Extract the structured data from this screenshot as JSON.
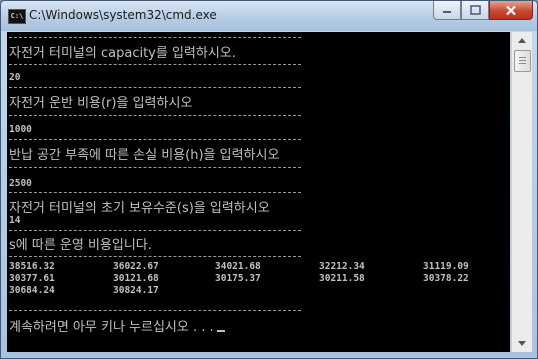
{
  "window": {
    "title": "C:\\Windows\\system32\\cmd.exe",
    "icon": "console-window-icon",
    "icon_text": "C:\\"
  },
  "controls": {
    "minimize": "minimize-icon",
    "maximize": "maximize-icon",
    "close": "close-icon"
  },
  "console": {
    "prompt_capacity": "자전거 터미널의 capacity를 입력하시오.",
    "capacity_value": "20",
    "prompt_transport_cost": "자전거 운반 비용(r)을 입력하시오",
    "transport_cost_value": "1000",
    "prompt_shortage_cost": "반납 공간 부족에 따른 손실 비용(h)을 입력하시오",
    "shortage_cost_value": "2500",
    "prompt_initial_stock": "자전거 터미널의 초기 보유수준(s)을 입력하시오",
    "initial_stock_value": "14",
    "result_header": "s에 따른 운영 비용입니다.",
    "results": [
      [
        "38516.32",
        "36022.67",
        "34021.68",
        "32212.34",
        "31119.09"
      ],
      [
        "30377.61",
        "30121.68",
        "30175.37",
        "30211.58",
        "30378.22"
      ],
      [
        "30684.24",
        "30824.17"
      ]
    ],
    "exit_prompt": "계속하려면 아무 키나 누르십시오 . . ."
  },
  "colors": {
    "console_background": "#000000",
    "console_text": "#c0c0c0",
    "close_button": "#c74a33"
  }
}
